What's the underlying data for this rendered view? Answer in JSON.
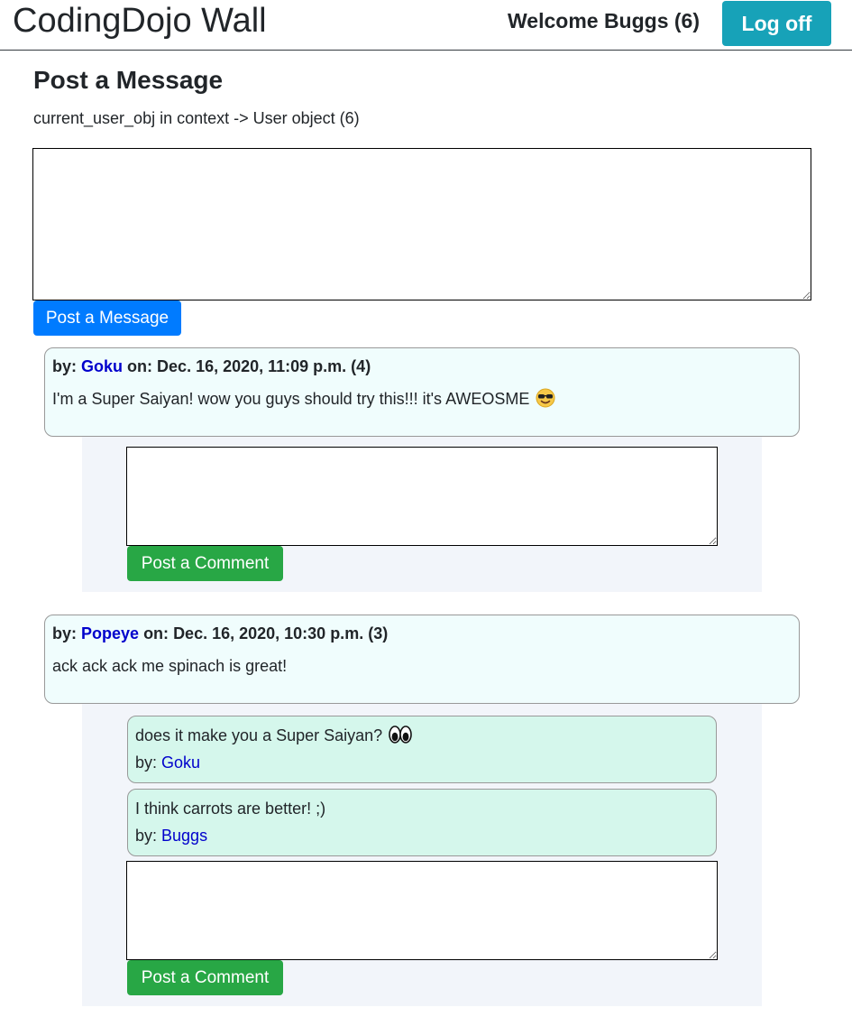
{
  "header": {
    "title": "CodingDojo Wall",
    "welcome": "Welcome Buggs (6)",
    "logoff_label": "Log off"
  },
  "post_form": {
    "heading": "Post a Message",
    "context_line": "current_user_obj in context -> User object (6)",
    "textarea_value": "",
    "button_label": "Post a Message"
  },
  "labels": {
    "by": "by:",
    "on": "on:",
    "comment_button": "Post a Comment"
  },
  "colors": {
    "logoff": "#17a2b8",
    "primary": "#007bff",
    "success": "#28a745",
    "message_bg": "#f0fdfd",
    "comment_bg": "#d5f7ec",
    "comment_area_bg": "#f2f5fa",
    "link": "#0000cc"
  },
  "messages": [
    {
      "author": "Goku",
      "date": "Dec. 16, 2020, 11:09 p.m. (4)",
      "text": "I'm a Super Saiyan! wow you guys should try this!!! it's AWEOSME",
      "emoji": "smiling-face-with-sunglasses-icon",
      "comments": []
    },
    {
      "author": "Popeye",
      "date": "Dec. 16, 2020, 10:30 p.m. (3)",
      "text": "ack ack ack me spinach is great!",
      "comments": [
        {
          "text": "does it make you a Super Saiyan?",
          "emoji": "eyes-icon",
          "author": "Goku"
        },
        {
          "text": "I think carrots are better! ;)",
          "author": "Buggs"
        }
      ]
    }
  ]
}
